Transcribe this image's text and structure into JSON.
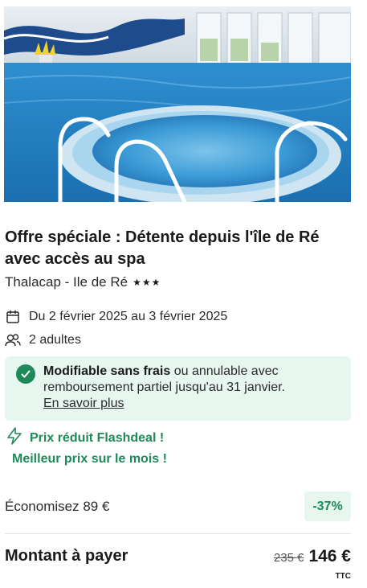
{
  "hero": {
    "image_alt": "indoor-pool-with-jacuzzi"
  },
  "offer": {
    "title": "Offre spéciale : Détente depuis l'île de Ré avec accès au spa",
    "hotel_name": "Thalacap - Ile de Ré",
    "stars": "★★★",
    "star_count": 3
  },
  "stay": {
    "dates": "Du 2 février 2025 au 3 février 2025",
    "guests": "2 adultes",
    "calendar_icon": "calendar-icon",
    "guests_icon": "users-icon"
  },
  "notice": {
    "bold": "Modifiable sans frais",
    "rest": " ou annulable avec remboursement partiel jusqu'au 31 janvier.",
    "link": "En savoir plus",
    "icon": "check-circle-icon"
  },
  "promo": {
    "flashdeal": "Prix réduit Flashdeal !",
    "best_price": "Meilleur prix sur le mois !",
    "icon": "lightning-icon"
  },
  "pricing": {
    "savings": "Économisez 89 €",
    "discount": "-37%",
    "total_label": "Montant à payer",
    "old_price": "235 €",
    "new_price": "146 €",
    "tax_note": "TTC"
  },
  "colors": {
    "accent_green": "#1e8a5a",
    "notice_bg": "#e8f6f0",
    "text": "#1a1a1a"
  }
}
